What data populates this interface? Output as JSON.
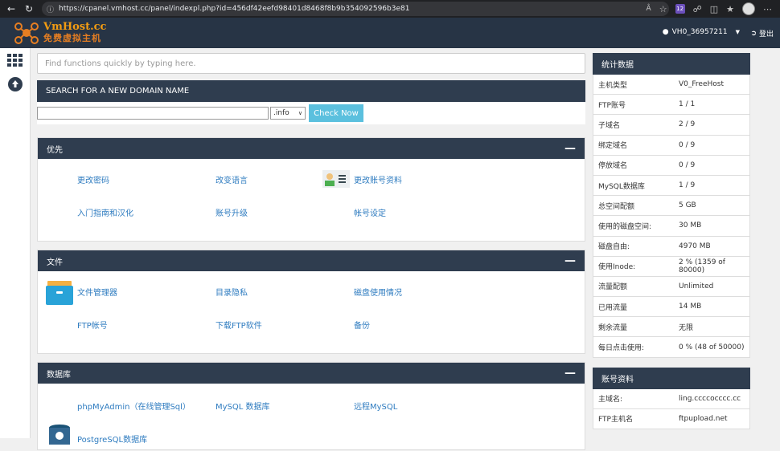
{
  "browser": {
    "url": "https://cpanel.vmhost.cc/panel/indexpl.php?id=456df42eefd98401d8468f8b9b354092596b3e81",
    "ext_badge": "12"
  },
  "header": {
    "brand": "VmHost.cc",
    "brand_sub": "免费虚拟主机",
    "user": "VH0_36957211",
    "logout": "登出"
  },
  "search": {
    "placeholder": "Find functions quickly by typing here."
  },
  "domain": {
    "title": "SEARCH FOR A NEW DOMAIN NAME",
    "tld": ".info",
    "button": "Check Now"
  },
  "panels": [
    {
      "title": "优先",
      "items": [
        "更改密码",
        "改变语言",
        "更改账号资料",
        "入门指南和汉化",
        "账号升级",
        "帐号设定"
      ]
    },
    {
      "title": "文件",
      "items": [
        "文件管理器",
        "目录隐私",
        "磁盘使用情况",
        "FTP帐号",
        "下载FTP软件",
        "备份"
      ]
    },
    {
      "title": "数据库",
      "items": [
        "phpMyAdmin（在线管理Sql）",
        "MySQL 数据库",
        "远程MySQL",
        "PostgreSQL数据库"
      ]
    }
  ],
  "stats": {
    "title": "统计数据",
    "rows": [
      {
        "k": "主机类型",
        "v": "V0_FreeHost"
      },
      {
        "k": "FTP账号",
        "v": "1 / 1"
      },
      {
        "k": "子域名",
        "v": "2 / 9"
      },
      {
        "k": "绑定域名",
        "v": "0 / 9"
      },
      {
        "k": "停放域名",
        "v": "0 / 9"
      },
      {
        "k": "MySQL数据库",
        "v": "1 / 9"
      },
      {
        "k": "总空间配额",
        "v": "5 GB"
      },
      {
        "k": "使用的磁盘空间:",
        "v": "30 MB"
      },
      {
        "k": "磁盘自由:",
        "v": "4970 MB"
      },
      {
        "k": "使用Inode:",
        "v": "2 % (1359 of 80000)"
      },
      {
        "k": "流量配额",
        "v": "Unlimited"
      },
      {
        "k": "已用流量",
        "v": "14 MB"
      },
      {
        "k": "剩余流量",
        "v": "无限"
      },
      {
        "k": "每日点击使用:",
        "v": "0 % (48 of 50000)"
      }
    ]
  },
  "account": {
    "title": "账号资料",
    "rows": [
      {
        "k": "主域名:",
        "v": "ling.ccccocccc.cc"
      },
      {
        "k": "FTP主机名",
        "v": "ftpupload.net"
      }
    ]
  },
  "colors": {
    "header": "#273445",
    "panel_head": "#2f3d4f",
    "link": "#2f7cc0",
    "button": "#5bc0de",
    "brand": "#f39c12"
  }
}
